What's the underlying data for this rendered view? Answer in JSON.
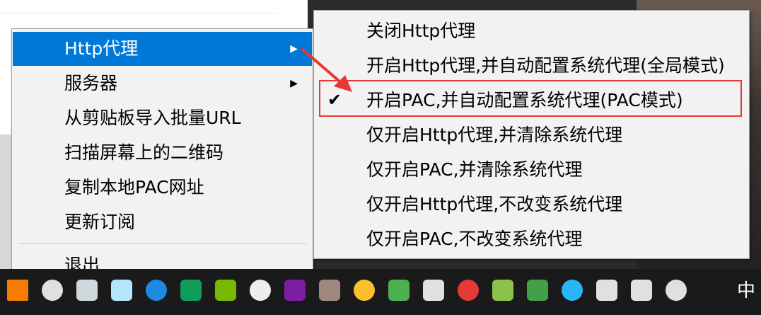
{
  "main_menu": {
    "items": [
      {
        "label": "Http代理",
        "has_submenu": true,
        "highlighted": true
      },
      {
        "label": "服务器",
        "has_submenu": true
      },
      {
        "label": "从剪贴板导入批量URL"
      },
      {
        "label": "扫描屏幕上的二维码"
      },
      {
        "label": "复制本地PAC网址"
      },
      {
        "label": "更新订阅"
      }
    ],
    "exit_label": "退出",
    "submenu_arrow": "▶"
  },
  "submenu": {
    "items": [
      {
        "label": "关闭Http代理"
      },
      {
        "label": "开启Http代理,并自动配置系统代理(全局模式)"
      },
      {
        "label": "开启PAC,并自动配置系统代理(PAC模式)",
        "checked": true
      },
      {
        "label": "仅开启Http代理,并清除系统代理"
      },
      {
        "label": "仅开启PAC,并清除系统代理"
      },
      {
        "label": "仅开启Http代理,不改变系统代理"
      },
      {
        "label": "仅开启PAC,不改变系统代理"
      }
    ],
    "check_mark": "✔"
  },
  "annotation": {
    "color": "#e53935"
  },
  "taskbar": {
    "icons": [
      {
        "name": "orange-app-icon",
        "color": "#f57c00"
      },
      {
        "name": "app-icon-2",
        "color": "#e0e0e0"
      },
      {
        "name": "app-icon-3",
        "color": "#cfd8dc"
      },
      {
        "name": "app-icon-4",
        "color": "#b3e5fc"
      },
      {
        "name": "globe-icon",
        "color": "#1e88e5"
      },
      {
        "name": "edge-icon",
        "color": "#0f9d58"
      },
      {
        "name": "nvidia-icon",
        "color": "#76b900"
      },
      {
        "name": "folder-icon",
        "color": "#eeeeee"
      },
      {
        "name": "purple-app-icon",
        "color": "#7b1fa2"
      },
      {
        "name": "user-avatar-icon",
        "color": "#a1887f"
      },
      {
        "name": "chrome-icon",
        "color": "#fbc02d"
      },
      {
        "name": "wechat-icon",
        "color": "#4caf50"
      },
      {
        "name": "usb-icon",
        "color": "#e0e0e0"
      },
      {
        "name": "mail-icon",
        "color": "#e53935"
      },
      {
        "name": "plus-icon",
        "color": "#8bc34a"
      },
      {
        "name": "shield-icon",
        "color": "#43a047"
      },
      {
        "name": "message-icon",
        "color": "#29b6f6"
      },
      {
        "name": "network-icon",
        "color": "#e0e0e0"
      },
      {
        "name": "monitor-icon",
        "color": "#e0e0e0"
      },
      {
        "name": "volume-icon",
        "color": "#e0e0e0"
      }
    ],
    "ime_label": "中",
    "volume_glyph": "🔊"
  }
}
